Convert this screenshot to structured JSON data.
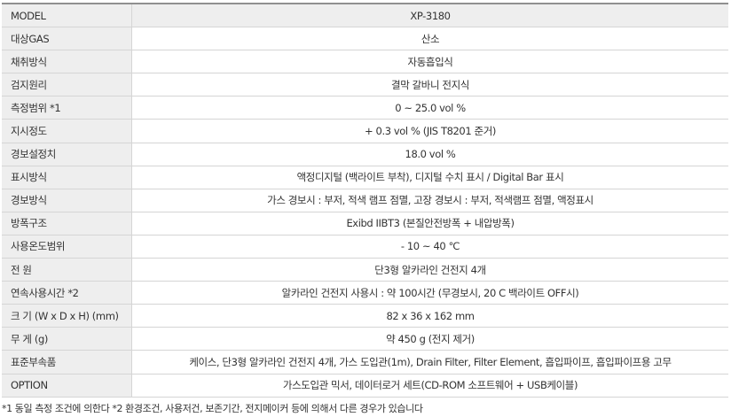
{
  "spec_table": {
    "rows": [
      {
        "label": "MODEL",
        "value": "XP-3180"
      },
      {
        "label": "대상GAS",
        "value": "산소"
      },
      {
        "label": "채취방식",
        "value": "자동흡입식"
      },
      {
        "label": "검지원리",
        "value": "결막 갈바니 전지식"
      },
      {
        "label": "측정범위 *1",
        "value": "0 ~ 25.0 vol %"
      },
      {
        "label": "지시정도",
        "value": "+ 0.3 vol % (JIS T8201 준거)"
      },
      {
        "label": "경보설정치",
        "value": "18.0 vol %"
      },
      {
        "label": "표시방식",
        "value": "액정디지털 (백라이트 부착), 디지털 수치 표시 / Digital Bar 표시"
      },
      {
        "label": "경보방식",
        "value": "가스 경보시 : 부저, 적색 램프 점멸, 고장 경보시 : 부저, 적색램프 점멸, 액정표시"
      },
      {
        "label": "방폭구조",
        "value": "Exibd IIBT3 (본질안전방폭 + 내압방폭)"
      },
      {
        "label": "사용온도범위",
        "value": "- 10 ~ 40 ℃"
      },
      {
        "label": "전 원",
        "value": "단3형 알카라인 건전지 4개"
      },
      {
        "label": "연속사용시간 *2",
        "value": "알카라인 건전지 사용시 : 약 100시간 (무경보시, 20 C 백라이트 OFF시)"
      },
      {
        "label": "크 기 (W x D x H) (mm)",
        "value": "82 x 36 x 162 mm"
      },
      {
        "label": "무 게 (g)",
        "value": "약 450 g (전지 제거)"
      },
      {
        "label": "표준부속품",
        "value": "케이스, 단3형 알카라인 건전지 4개, 가스 도입관(1m), Drain Filter, Filter Element, 흡입파이프, 흡입파이프용 고무"
      },
      {
        "label": "OPTION",
        "value": "가스도입관 믹서, 데이터로거 세트(CD-ROM 소프트웨어 + USB케이블)"
      }
    ]
  },
  "footnote": "*1 동일 측정 조건에 의한다 *2 환경조건, 사용저건, 보존기간, 전지메이커 등에 의해서 다른 경우가 있습니다"
}
